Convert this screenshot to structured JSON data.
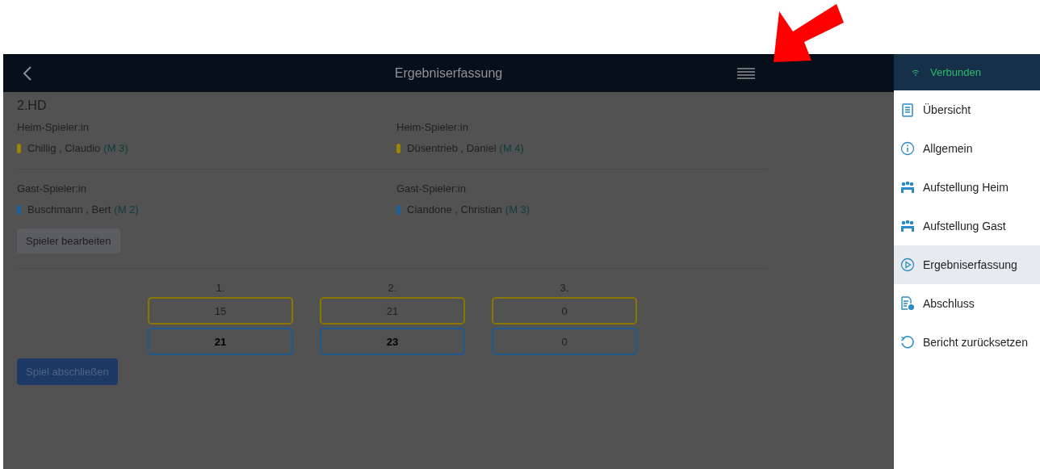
{
  "header": {
    "title": "Ergebniserfassung"
  },
  "match": {
    "title": "2.HD",
    "teams": [
      {
        "players": [
          {
            "label": "Heim-Spieler:in",
            "name": "Chillig , Claudio",
            "rank": "(M 3)",
            "color": "#9c8500"
          },
          {
            "label": "Heim-Spieler:in",
            "name": "Düsentrieb , Daniel",
            "rank": "(M 4)",
            "color": "#9c8500"
          }
        ]
      },
      {
        "players": [
          {
            "label": "Gast-Spieler:in",
            "name": "Buschmann , Bert",
            "rank": "(M 2)",
            "color": "#1d5f99"
          },
          {
            "label": "Gast-Spieler:in",
            "name": "Ciandone , Christian",
            "rank": "(M 3)",
            "color": "#1d5f99"
          }
        ]
      }
    ],
    "edit_button": "Spieler bearbeiten",
    "sets": [
      {
        "label": "1.",
        "home": "15",
        "guest": "21",
        "home_won": false,
        "guest_won": true
      },
      {
        "label": "2.",
        "home": "21",
        "guest": "23",
        "home_won": false,
        "guest_won": true
      },
      {
        "label": "3.",
        "home": "0",
        "guest": "0",
        "home_won": false,
        "guest_won": false
      }
    ],
    "finish_button": "Spiel abschließen"
  },
  "sidebar": {
    "status": "Verbunden",
    "items": [
      {
        "label": "Übersicht",
        "kind": "clipboard",
        "selected": false
      },
      {
        "label": "Allgemein",
        "kind": "info",
        "selected": false
      },
      {
        "label": "Aufstellung Heim",
        "kind": "team",
        "selected": false
      },
      {
        "label": "Aufstellung Gast",
        "kind": "team",
        "selected": false
      },
      {
        "label": "Ergebniserfassung",
        "kind": "play",
        "selected": true
      },
      {
        "label": "Abschluss",
        "kind": "document",
        "selected": false
      },
      {
        "label": "Bericht zurücksetzen",
        "kind": "reset",
        "selected": false
      }
    ]
  }
}
